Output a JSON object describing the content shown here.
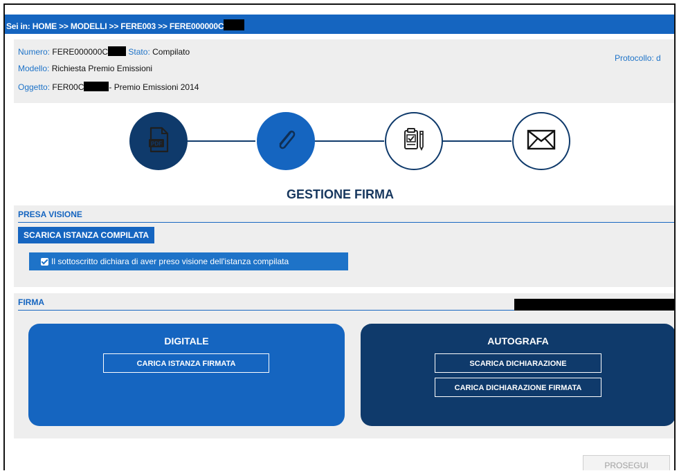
{
  "breadcrumb": {
    "prefix": "Sei in: ",
    "path": "HOME >> MODELLI >> FERE003 >> FERE000000C"
  },
  "info": {
    "numero_label": "Numero:",
    "numero_value": "FERE000000C",
    "stato_label": "Stato:",
    "stato_value": "Compilato",
    "protocollo_label": "Protocollo: d",
    "modello_label": "Modello:",
    "modello_value": "Richiesta Premio Emissioni",
    "oggetto_label": "Oggetto:",
    "oggetto_value_prefix": "FER00C",
    "oggetto_value_suffix": "- Premio Emissioni 2014"
  },
  "steps": [
    {
      "icon": "pdf-icon",
      "state": "done"
    },
    {
      "icon": "paperclip-icon",
      "state": "active"
    },
    {
      "icon": "clipboard-check-icon",
      "state": "todo"
    },
    {
      "icon": "envelope-icon",
      "state": "todo"
    }
  ],
  "page_title": "GESTIONE FIRMA",
  "presa_visione": {
    "heading": "PRESA VISIONE",
    "download_button": "SCARICA ISTANZA COMPILATA",
    "checkbox_label": "Il sottoscritto dichiara di aver preso visione dell'istanza compilata",
    "checked": true
  },
  "firma": {
    "heading": "FIRMA",
    "digitale": {
      "title": "DIGITALE",
      "upload_button": "CARICA ISTANZA FIRMATA"
    },
    "autografa": {
      "title": "AUTOGRAFA",
      "download_button": "SCARICA DICHIARAZIONE",
      "upload_button": "CARICA DICHIARAZIONE FIRMATA"
    }
  },
  "footer": {
    "prosegui_button": "PROSEGUI"
  },
  "colors": {
    "primary": "#1565c0",
    "dark": "#0f3a6b",
    "panel": "#eeeeee",
    "redaction": "#000000"
  }
}
